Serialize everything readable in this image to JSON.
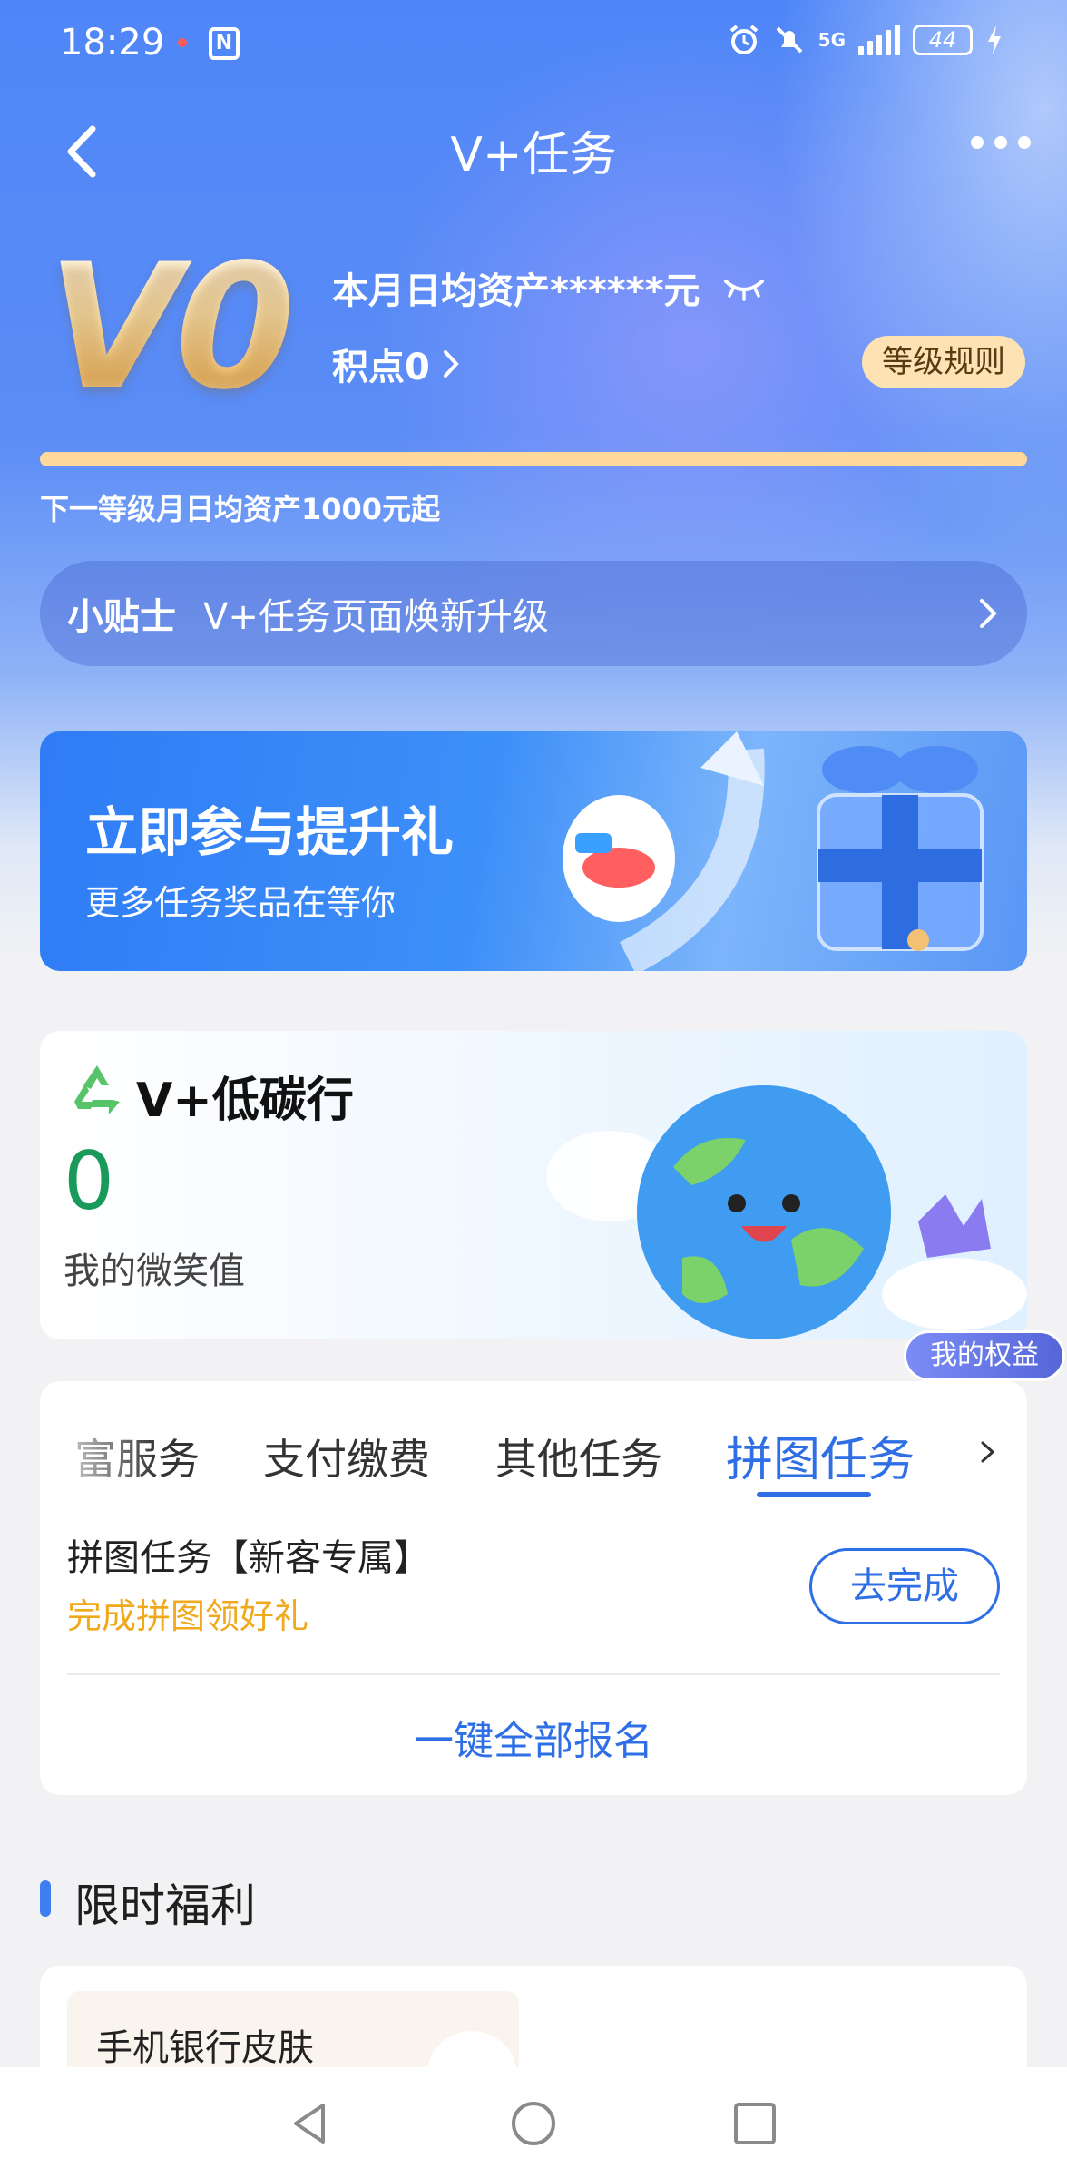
{
  "status_bar": {
    "time": "18:29",
    "network": "5G",
    "battery": "44"
  },
  "nav": {
    "title": "V+任务",
    "back_icon": "chevron-left-icon",
    "more_icon": "more-dots-icon"
  },
  "level": {
    "badge": "V0",
    "asset_text": "本月日均资产******元",
    "points_text": "积点0",
    "rule_button": "等级规则",
    "progress": 0,
    "next_level_text": "下一等级月日均资产1000元起"
  },
  "tip": {
    "title": "小贴士",
    "text": "V+任务页面焕新升级"
  },
  "banner": {
    "title": "立即参与提升礼",
    "subtitle": "更多任务奖品在等你"
  },
  "carbon": {
    "title": "V+低碳行",
    "value": "0",
    "value_label": "我的微笑值",
    "rights_badge": "我的权益"
  },
  "tasks": {
    "tabs": [
      "富服务",
      "支付缴费",
      "其他任务",
      "拼图任务"
    ],
    "active_tab": 3,
    "item_name": "拼图任务【新客专属】",
    "item_desc": "完成拼图领好礼",
    "item_button": "去完成",
    "enroll_all": "一键全部报名"
  },
  "welfare": {
    "section_title": "限时福利",
    "item_label": "手机银行皮肤"
  },
  "colors": {
    "accent_blue": "#2f6fe6",
    "gold": "#f0a91c",
    "smile_green": "#1a9a5a"
  }
}
